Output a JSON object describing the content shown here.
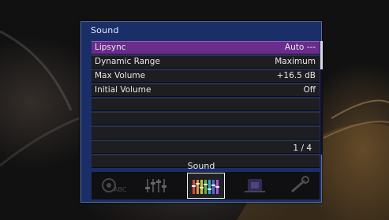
{
  "panel": {
    "title": "Sound"
  },
  "menu": {
    "items": [
      {
        "label": "Lipsync",
        "value": "Auto ---",
        "selected": true
      },
      {
        "label": "Dynamic Range",
        "value": "Maximum",
        "selected": false
      },
      {
        "label": "Max Volume",
        "value": "+16.5 dB",
        "selected": false
      },
      {
        "label": "Initial Volume",
        "value": "Off",
        "selected": false
      },
      {
        "label": "",
        "value": ""
      },
      {
        "label": "",
        "value": ""
      },
      {
        "label": "",
        "value": ""
      },
      {
        "label": "",
        "value": ""
      },
      {
        "label": "",
        "value": ""
      }
    ],
    "page_indicator": "1 / 4"
  },
  "category_bar": {
    "current_label": "Sound",
    "categories": [
      {
        "icon": "abc-speaker-icon",
        "selected": false
      },
      {
        "icon": "equalizer-icon",
        "selected": false
      },
      {
        "icon": "sound-levels-icon",
        "selected": true
      },
      {
        "icon": "scene-icon",
        "selected": false
      },
      {
        "icon": "wrench-icon",
        "selected": false
      }
    ]
  },
  "colors": {
    "panel_bg": "#1a2f67",
    "selected_row": "#6a2d8c",
    "row_bg": "#1e1e22",
    "text": "#e8e8ec"
  }
}
